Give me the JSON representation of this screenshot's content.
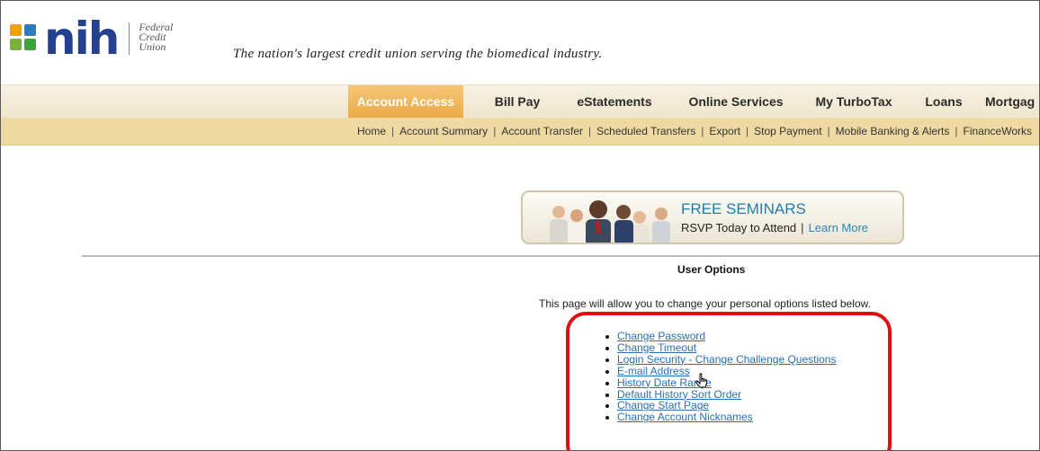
{
  "header": {
    "logo_text": "nih",
    "logo_subtext": [
      "Federal",
      "Credit",
      "Union"
    ],
    "tagline": "The nation's largest credit union serving the biomedical industry.",
    "logo_colors": [
      "#f1a200",
      "#2d7cc2",
      "#7ab241",
      "#3ca43c"
    ]
  },
  "nav": {
    "items": [
      {
        "label": "Account Access",
        "active": true
      },
      {
        "label": "Bill Pay"
      },
      {
        "label": "eStatements"
      },
      {
        "label": "Online Services"
      },
      {
        "label": "My TurboTax"
      },
      {
        "label": "Loans"
      },
      {
        "label": "Mortgag"
      }
    ],
    "active_color": "#f1b85a"
  },
  "subnav": {
    "items": [
      "Home",
      "Account Summary",
      "Account Transfer",
      "Scheduled Transfers",
      "Export",
      "Stop Payment",
      "Mobile Banking & Alerts",
      "FinanceWorks"
    ],
    "separator": "|"
  },
  "banner": {
    "title": "FREE SEMINARS",
    "subtitle": "RSVP Today to Attend",
    "separator": "|",
    "link": "Learn More"
  },
  "main": {
    "heading": "User Options",
    "intro": "This page will allow you to change your personal options listed below.",
    "options": [
      "Change Password",
      "Change Timeout",
      "Login Security - Change Challenge Questions",
      "E-mail Address",
      "History Date Range",
      "Default History Sort Order",
      "Change Start Page",
      "Change Account Nicknames"
    ]
  },
  "colors": {
    "link": "#2b6fb6",
    "highlight": "#e01010",
    "subnav_bg": "#efd9a3"
  }
}
